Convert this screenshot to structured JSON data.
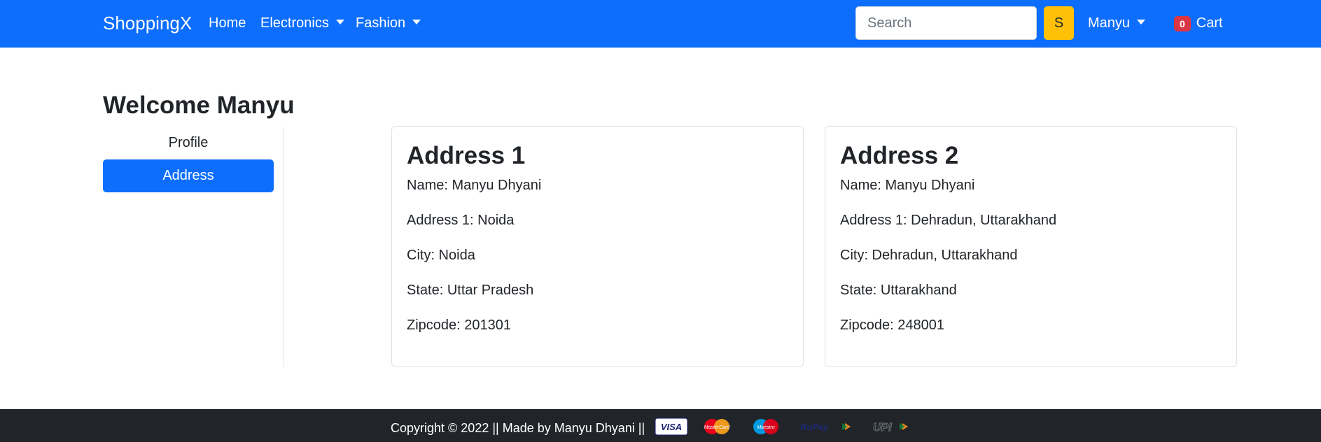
{
  "navbar": {
    "brand": "ShoppingX",
    "links": [
      {
        "label": "Home"
      },
      {
        "label": "Electronics"
      },
      {
        "label": "Fashion"
      }
    ],
    "search_placeholder": "Search",
    "search_button": "S",
    "user_menu": "Manyu",
    "cart": {
      "count": "0",
      "label": "Cart"
    }
  },
  "main": {
    "welcome": "Welcome Manyu",
    "sidebar": [
      {
        "label": "Profile",
        "active": false
      },
      {
        "label": "Address",
        "active": true
      }
    ],
    "addresses": [
      {
        "title": "Address 1",
        "name": "Name: Manyu Dhyani",
        "address": "Address 1: Noida",
        "city": "City: Noida",
        "state": "State: Uttar Pradesh",
        "zip": "Zipcode: 201301"
      },
      {
        "title": "Address 2",
        "name": "Name: Manyu Dhyani",
        "address": "Address 1: Dehradun, Uttarakhand",
        "city": "City: Dehradun, Uttarakhand",
        "state": "State: Uttarakhand",
        "zip": "Zipcode: 248001"
      }
    ]
  },
  "footer": {
    "copyright": "Copyright © 2022 || Made by Manyu Dhyani ||",
    "payment_icons": [
      "visa-icon",
      "mastercard-icon",
      "maestro-icon",
      "rupay-icon",
      "upi-icon"
    ],
    "payment_labels": {
      "visa": "VISA",
      "mastercard": "MasterCard",
      "maestro": "Maestro",
      "rupay": "RuPay",
      "upi": "UPI"
    }
  },
  "colors": {
    "primary": "#0d6efd",
    "warning": "#ffc107",
    "danger": "#dc3545",
    "dark": "#212529"
  }
}
